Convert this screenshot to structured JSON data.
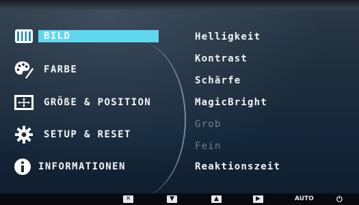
{
  "main_menu": {
    "items": [
      {
        "label": "BILD",
        "icon": "picture-icon",
        "selected": true
      },
      {
        "label": "FARBE",
        "icon": "palette-icon",
        "selected": false
      },
      {
        "label": "GRÖßE & POSITION",
        "icon": "size-position-icon",
        "selected": false
      },
      {
        "label": "SETUP & RESET",
        "icon": "gear-icon",
        "selected": false
      },
      {
        "label": "INFORMATIONEN",
        "icon": "info-icon",
        "selected": false
      }
    ]
  },
  "submenu": {
    "items": [
      {
        "label": "Helligkeit",
        "enabled": true
      },
      {
        "label": "Kontrast",
        "enabled": true
      },
      {
        "label": "Schärfe",
        "enabled": true
      },
      {
        "label": "MagicBright",
        "enabled": true
      },
      {
        "label": "Grob",
        "enabled": false
      },
      {
        "label": "Fein",
        "enabled": false
      },
      {
        "label": "Reaktionszeit",
        "enabled": true
      }
    ]
  },
  "bottom_bar": {
    "buttons": [
      {
        "icon": "close-icon",
        "glyph": "✕"
      },
      {
        "icon": "down-arrow-icon",
        "glyph": "▼"
      },
      {
        "icon": "up-arrow-icon",
        "glyph": "▲"
      },
      {
        "icon": "right-arrow-icon",
        "glyph": "▶"
      },
      {
        "icon": "auto-label",
        "glyph": "AUTO"
      },
      {
        "icon": "power-icon",
        "glyph": "⏻"
      }
    ]
  },
  "colors": {
    "highlight": "#5fd8ef",
    "text": "#f4f6f8",
    "disabled_text": "#6f7f8c",
    "background": "#1e2d3c"
  }
}
